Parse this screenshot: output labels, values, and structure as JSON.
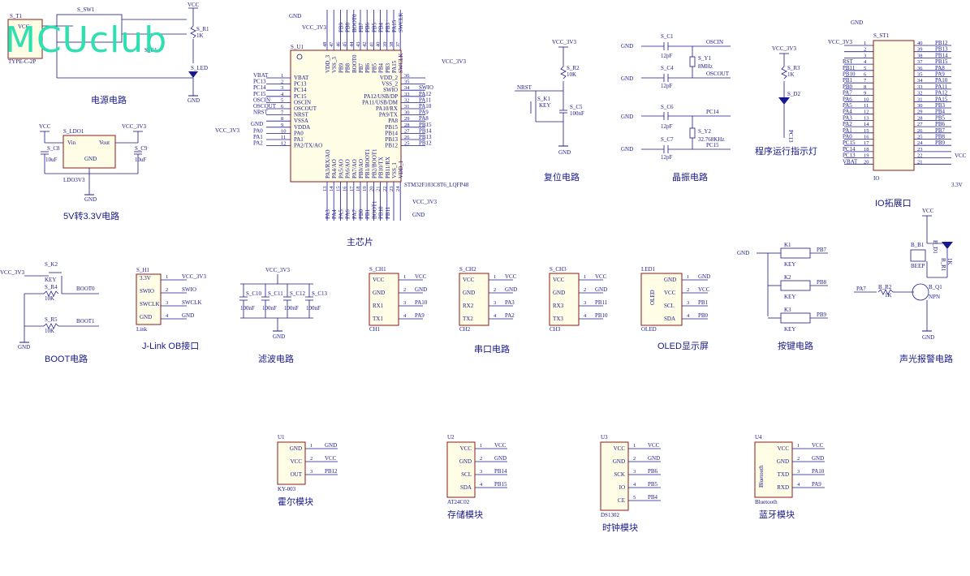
{
  "brand": "MCUclub",
  "sections": {
    "power": "电源电路",
    "ldo": "5V转3.3V电路",
    "mcu": "主芯片",
    "reset": "复位电路",
    "crystal": "晶振电路",
    "led": "程序运行指示灯",
    "io": "IO拓展口",
    "boot": "BOOT电路",
    "jlink": "J-Link OB接口",
    "filter": "滤波电路",
    "uart": "串口电路",
    "oled": "OLED显示屏",
    "keys": "按键电路",
    "alarm": "声光报警电路",
    "hall": "霍尔模块",
    "storage": "存储模块",
    "clock": "时钟模块",
    "bt": "蓝牙模块"
  },
  "mcu": {
    "ref": "S_U1",
    "part": "STM32F103C8T6_LQFP48",
    "left": [
      [
        "VBAT",
        "1"
      ],
      [
        "PC13",
        "2"
      ],
      [
        "PC14",
        "3"
      ],
      [
        "PC15",
        "4"
      ],
      [
        "OSCIN",
        "5"
      ],
      [
        "OSCOUT",
        "6"
      ],
      [
        "NRST",
        "7"
      ],
      [
        "VSSA",
        "8"
      ],
      [
        "VDDA",
        "9"
      ],
      [
        "PA0",
        "10"
      ],
      [
        "PA1",
        "11"
      ],
      [
        "PA2/TX/AO",
        "12"
      ]
    ],
    "right": [
      [
        "VDD_2",
        "36"
      ],
      [
        "VSS_2",
        "35"
      ],
      [
        "SWIO",
        "34"
      ],
      [
        "PA12/USB/DP",
        "33"
      ],
      [
        "PA11/USB/DM",
        "32"
      ],
      [
        "PA10/RX",
        "31"
      ],
      [
        "PA9/TX",
        "30"
      ],
      [
        "PA8",
        "29"
      ],
      [
        "PB15",
        "28"
      ],
      [
        "PB14",
        "27"
      ],
      [
        "PB13",
        "26"
      ],
      [
        "PB12",
        "25"
      ]
    ],
    "top": [
      [
        "VDD_3",
        "48"
      ],
      [
        "VSS_3",
        "47"
      ],
      [
        "PB9",
        "46"
      ],
      [
        "PB8",
        "45"
      ],
      [
        "BOOT0",
        "44"
      ],
      [
        "PB7",
        "43"
      ],
      [
        "PB6",
        "42"
      ],
      [
        "PB5",
        "41"
      ],
      [
        "PB4",
        "40"
      ],
      [
        "PB3",
        "39"
      ],
      [
        "PA15",
        "38"
      ],
      [
        "SWCLK",
        "37"
      ]
    ],
    "bottom": [
      [
        "PA3/RX/AO",
        "13"
      ],
      [
        "PA4/AO",
        "14"
      ],
      [
        "PA5/AO",
        "15"
      ],
      [
        "PA6/AO",
        "16"
      ],
      [
        "PA7/AO",
        "17"
      ],
      [
        "PB0/AO",
        "18"
      ],
      [
        "PB1/BOOT1",
        "19"
      ],
      [
        "PB2/BOOT1",
        "20"
      ],
      [
        "PB10/TX",
        "21"
      ],
      [
        "PB11/RX",
        "22"
      ],
      [
        "VSS_1",
        "23"
      ],
      [
        "VDD_1",
        "24"
      ]
    ],
    "net_left": [
      "VBAT",
      "PC13",
      "PC14",
      "PC15",
      "OSCIN",
      "OSCOUT",
      "NRST",
      "",
      "",
      "PA0",
      "PA1",
      "PA2"
    ],
    "net_right": [
      "",
      "",
      "SWIO",
      "PA12",
      "PA11",
      "PA10",
      "PA9",
      "PA8",
      "PB15",
      "PB14",
      "PB13",
      "PB12"
    ],
    "net_top": [
      "",
      "",
      "PB9",
      "PB8",
      "BOOT0",
      "PB7",
      "PB6",
      "PB5",
      "PB4",
      "PB3",
      "PA15",
      "SWCLK"
    ],
    "net_bottom": [
      "PA3",
      "PA4",
      "PA5",
      "PA6",
      "PA7",
      "PB0",
      "PB1",
      "BOOT1",
      "PB10",
      "PB11",
      "",
      ""
    ],
    "vcc_left": "VCC_3V3",
    "gnd_left": "GND",
    "vcc_top": "VCC_3V3",
    "gnd_top": "GND",
    "vcc_right": "VCC_3V3",
    "vcc_bottom": "VCC_3V3",
    "gnd_bottom": "GND"
  },
  "power": {
    "vcc": "VCC",
    "conn": "S_T1",
    "conn_type": "TYPE-C-2P",
    "sw": "S_SW1",
    "r1": "S_R1",
    "r1_val": "1K",
    "led": "S_LED",
    "cap": "S_C1",
    "gnd": "GND"
  },
  "ldo": {
    "ref": "S_LDO1",
    "vin": "Vin",
    "vout": "Vout",
    "gnd": "GND",
    "part": "LDO3V3",
    "c8": "S_C8",
    "c8_val": "10uF",
    "c9": "S_C9",
    "c9_val": "10uF",
    "vcc_in": "VCC",
    "vcc_out": "VCC_3V3",
    "gnd_net": "GND"
  },
  "reset": {
    "vcc": "VCC_3V3",
    "r2": "S_R2",
    "r2_val": "10K",
    "nrst": "NRST",
    "k1": "S_K1",
    "key": "KEY",
    "c5": "S_C5",
    "c5_val": "100nF",
    "gnd": "GND"
  },
  "crystal": {
    "gnd": "GND",
    "c1": "S_C1",
    "c4": "S_C4",
    "c6": "S_C6",
    "c7": "S_C7",
    "cap_val": "12pF",
    "y1": "S_Y1",
    "y1_val": "8MHz",
    "y2": "S_Y2",
    "y2_val": "32.768KHz",
    "oscin": "OSCIN",
    "oscout": "OSCOUT",
    "pc14": "PC14",
    "pc15": "PC15"
  },
  "indicator": {
    "vcc": "VCC_3V3",
    "r3": "S_R3",
    "r3_val": "1K",
    "d2": "S_D2",
    "pc13": "PC13"
  },
  "io": {
    "ref": "S_ST1",
    "gnd": "GND",
    "vcc": "VCC_3V3",
    "part": "IO",
    "left_pins": [
      "1",
      "2",
      "3",
      "4",
      "5",
      "6",
      "7",
      "8",
      "9",
      "10",
      "11",
      "12",
      "13",
      "14",
      "15",
      "16",
      "17",
      "18",
      "19",
      "20"
    ],
    "right_pins": [
      "40",
      "39",
      "38",
      "37",
      "36",
      "35",
      "34",
      "33",
      "32",
      "31",
      "30",
      "29",
      "28",
      "27",
      "26",
      "25",
      "24",
      "23",
      "22",
      "21"
    ],
    "left_nets": [
      "",
      "",
      "",
      "RST",
      "PB11",
      "PB10",
      "PB1",
      "PB0",
      "PA7",
      "PA6",
      "PA5",
      "PA4",
      "PA3",
      "PA2",
      "PA1",
      "PA0",
      "PC15",
      "PC14",
      "PC13",
      "VBAT"
    ],
    "right_nets": [
      "PB12",
      "PB13",
      "PB14",
      "PB15",
      "PA8",
      "PA9",
      "PA10",
      "PA11",
      "PA12",
      "PA15",
      "PB3",
      "PB4",
      "PB5",
      "PB6",
      "PB7",
      "PB8",
      "PB9",
      "",
      "",
      ""
    ],
    "vcc_right": "VCC",
    "v33": "3.3V"
  },
  "boot": {
    "vcc": "VCC_3V3",
    "k2": "S_K2",
    "key": "KEY",
    "r4": "S_R4",
    "r4_val": "10K",
    "boot0": "BOOT0",
    "r5": "S_R5",
    "r5_val": "10K",
    "boot1": "BOOT1",
    "gnd": "GND"
  },
  "jlink": {
    "ref": "S_H1",
    "pins": [
      [
        "3.3V",
        "1",
        "VCC_3V3"
      ],
      [
        "SWIO",
        "2",
        "SWIO"
      ],
      [
        "SWCLK",
        "3",
        "SWCLK"
      ],
      [
        "GND",
        "4",
        "GND"
      ]
    ],
    "part": "Link"
  },
  "filter": {
    "vcc": "VCC_3V3",
    "caps": [
      [
        "S_C10",
        "100nF"
      ],
      [
        "S_C11",
        "100nF"
      ],
      [
        "S_C12",
        "100nF"
      ],
      [
        "S_C13",
        "100nF"
      ]
    ],
    "gnd": "GND"
  },
  "uart": [
    {
      "ref": "S_CH1",
      "part": "CH1",
      "pins": [
        [
          "VCC",
          "1",
          "VCC"
        ],
        [
          "GND",
          "2",
          "GND"
        ],
        [
          "RX1",
          "3",
          "PA10"
        ],
        [
          "TX1",
          "4",
          "PA9"
        ]
      ]
    },
    {
      "ref": "S_CH2",
      "part": "CH2",
      "pins": [
        [
          "VCC",
          "1",
          "VCC"
        ],
        [
          "GND",
          "2",
          "GND"
        ],
        [
          "RX2",
          "3",
          "PA3"
        ],
        [
          "TX2",
          "4",
          "PA2"
        ]
      ]
    },
    {
      "ref": "S_CH3",
      "part": "CH3",
      "pins": [
        [
          "VCC",
          "1",
          "VCC"
        ],
        [
          "GND",
          "2",
          "GND"
        ],
        [
          "RX3",
          "3",
          "PB11"
        ],
        [
          "TX3",
          "4",
          "PB10"
        ]
      ]
    }
  ],
  "oled": {
    "ref": "LED1",
    "part": "OLED",
    "inner": "OLED",
    "pins": [
      [
        "GND",
        "1",
        "GND"
      ],
      [
        "VCC",
        "2",
        "VCC"
      ],
      [
        "SCL",
        "3",
        "PB1"
      ],
      [
        "SDA",
        "4",
        "PB0"
      ]
    ]
  },
  "keys": {
    "gnd": "GND",
    "items": [
      [
        "K1",
        "KEY",
        "PB7"
      ],
      [
        "K2",
        "KEY",
        "PB8"
      ],
      [
        "K3",
        "KEY",
        "PB9"
      ]
    ]
  },
  "alarm": {
    "vcc": "VCC",
    "b1": "B_B1",
    "beep": "BEEP",
    "d1": "B_D1",
    "r1": "B_R1",
    "r1_val": "1K",
    "r2": "B_R2",
    "r2_val": "1K",
    "pa7": "PA7",
    "q1": "B_Q1",
    "npn": "NPN",
    "gnd": "GND"
  },
  "modules": [
    {
      "ref": "U1",
      "part": "KY-003",
      "pins": [
        [
          "GND",
          "1",
          "GND"
        ],
        [
          "VCC",
          "2",
          "VCC"
        ],
        [
          "OUT",
          "3",
          "PB12"
        ]
      ]
    },
    {
      "ref": "U2",
      "part": "AT24C02",
      "pins": [
        [
          "VCC",
          "1",
          "VCC"
        ],
        [
          "GND",
          "2",
          "GND"
        ],
        [
          "SCL",
          "3",
          "PB14"
        ],
        [
          "SDA",
          "4",
          "PB15"
        ]
      ]
    },
    {
      "ref": "U3",
      "part": "DS1302",
      "pins": [
        [
          "VCC",
          "1",
          "VCC"
        ],
        [
          "GND",
          "2",
          "GND"
        ],
        [
          "SCK",
          "3",
          "PB6"
        ],
        [
          "IO",
          "4",
          "PB5"
        ],
        [
          "CE",
          "5",
          "PB4"
        ]
      ]
    },
    {
      "ref": "U4",
      "part": "Bluetooth",
      "inner": "Bluetooth",
      "pins": [
        [
          "VCC",
          "1",
          "VCC"
        ],
        [
          "GND",
          "2",
          "GND"
        ],
        [
          "TXD",
          "3",
          "PA10"
        ],
        [
          "RXD",
          "4",
          "PA9"
        ]
      ]
    }
  ]
}
